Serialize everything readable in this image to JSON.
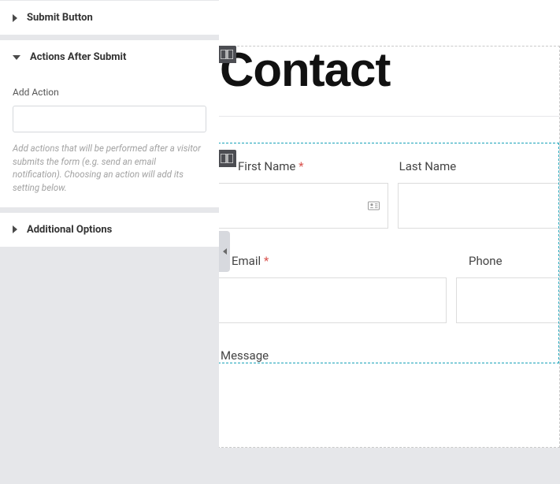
{
  "sidebar": {
    "sections": [
      {
        "label": "Submit Button",
        "expanded": false
      },
      {
        "label": "Actions After Submit",
        "expanded": true
      },
      {
        "label": "Additional Options",
        "expanded": false
      }
    ],
    "actions_after_submit": {
      "add_action_label": "Add Action",
      "help_text": "Add actions that will be performed after a visitor submits the form (e.g. send an email notification). Choosing an action will add its setting below."
    }
  },
  "canvas": {
    "heading": "Contact",
    "form": {
      "fields": [
        {
          "label": "First Name",
          "required": true,
          "name": "first-name"
        },
        {
          "label": "Last Name",
          "required": false,
          "name": "last-name"
        },
        {
          "label": "Email",
          "required": true,
          "name": "email"
        },
        {
          "label": "Phone",
          "required": false,
          "name": "phone"
        },
        {
          "label": "Message",
          "required": false,
          "name": "message"
        }
      ]
    }
  }
}
